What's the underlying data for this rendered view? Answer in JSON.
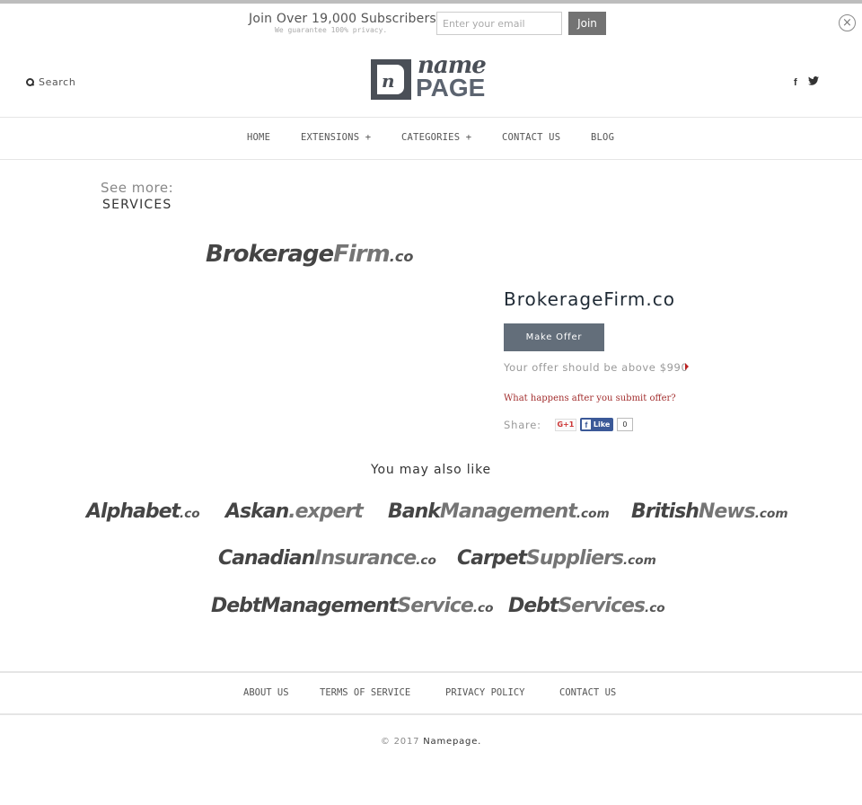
{
  "subscribe": {
    "title": "Join Over 19,000 Subscribers",
    "note": "We guarantee 100% privacy.",
    "email_placeholder": "Enter your email",
    "join_label": "Join",
    "close_icon": "close-circle-icon"
  },
  "header": {
    "search_label": "Search",
    "search_icon": "search-icon",
    "logo": {
      "mark": "n",
      "top": "name",
      "bottom": "PAGE"
    },
    "social": [
      {
        "name": "facebook-icon",
        "glyph": "f"
      },
      {
        "name": "twitter-icon",
        "glyph": "🐦"
      }
    ]
  },
  "nav": {
    "items": [
      {
        "label": "HOME"
      },
      {
        "label": "EXTENSIONS +"
      },
      {
        "label": "CATEGORIES +"
      },
      {
        "label": "CONTACT US"
      },
      {
        "label": "BLOG"
      }
    ]
  },
  "breadcrumb": {
    "see_more": "See more:",
    "category": "SERVICES"
  },
  "product": {
    "logo": {
      "a": "Brokerage",
      "b": "Firm",
      "tld": ".co"
    },
    "title": "BrokerageFirm.co",
    "make_offer_label": "Make Offer",
    "offer_text": "Your offer should be above $990",
    "what_happens": "What happens after you submit offer?",
    "share_label": "Share:",
    "gplus_label": "G+1",
    "fb_like_label": "Like",
    "fb_count": "0"
  },
  "related": {
    "heading": "You may also like",
    "items": [
      {
        "a": "Alphabet",
        "b": "",
        "tld": ".co"
      },
      {
        "a": "Askan",
        "b": ".expert",
        "tld": ""
      },
      {
        "a": "Bank",
        "b": "Management",
        "tld": ".com"
      },
      {
        "a": "British",
        "b": "News",
        "tld": ".com"
      },
      {
        "a": "Canadian",
        "b": "Insurance",
        "tld": ".co"
      },
      {
        "a": "Carpet",
        "b": "Suppliers",
        "tld": ".com"
      },
      {
        "a": "DebtManagement",
        "b": "Service",
        "tld": ".co"
      },
      {
        "a": "Debt",
        "b": "Services",
        "tld": ".co"
      }
    ]
  },
  "footer": {
    "links": [
      {
        "label": "ABOUT US"
      },
      {
        "label": "TERMS OF SERVICE"
      },
      {
        "label": "PRIVACY POLICY"
      },
      {
        "label": "CONTACT US"
      }
    ],
    "copyright_prefix": "© 2017",
    "brand": "Namepage."
  }
}
